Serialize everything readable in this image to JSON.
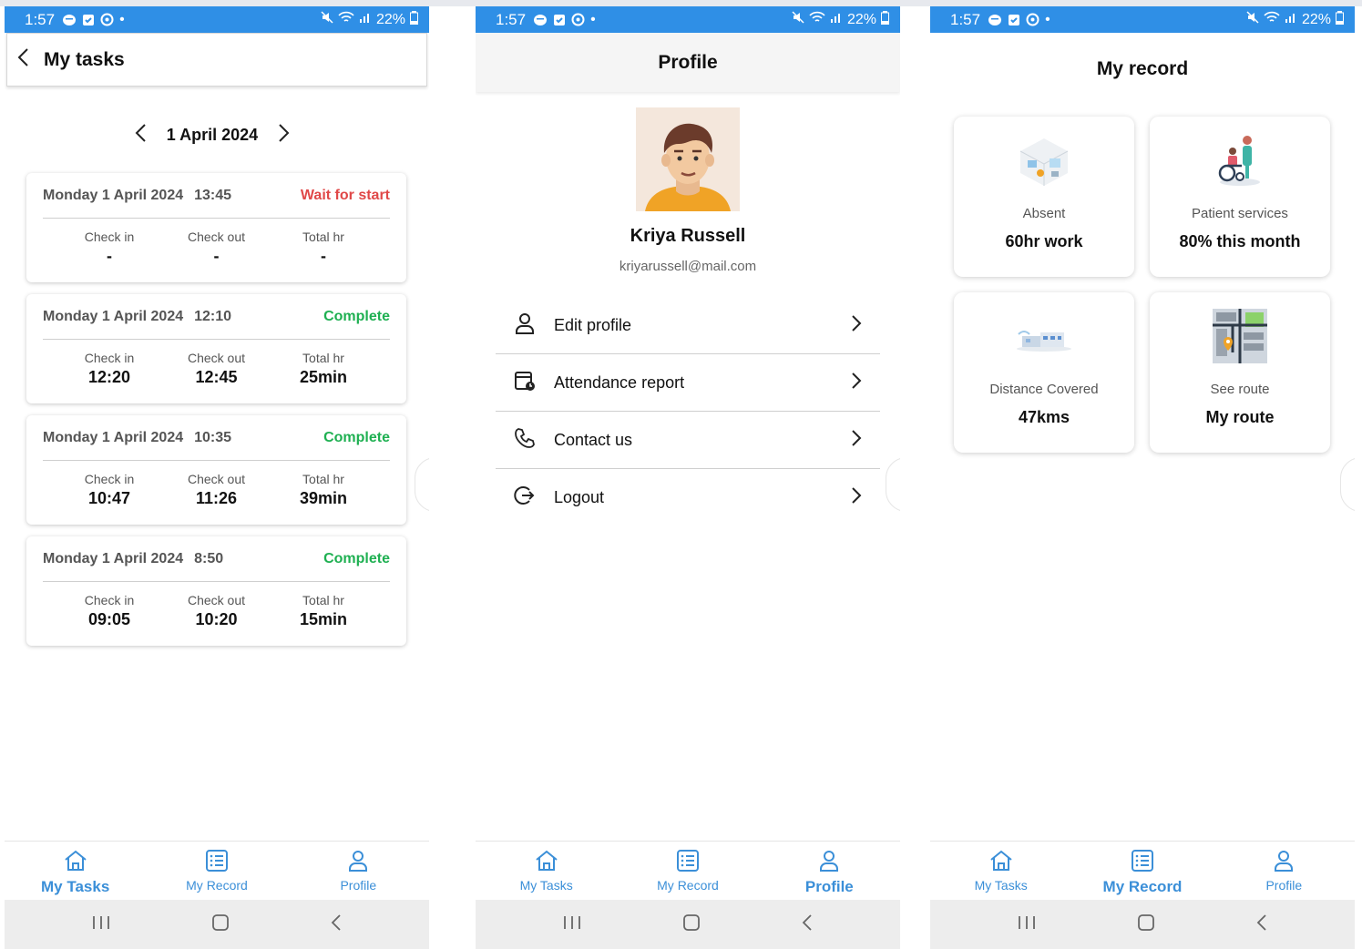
{
  "statusbar": {
    "time": "1:57",
    "battery": "22%"
  },
  "tasks": {
    "title": "My tasks",
    "date": "1 April 2024",
    "col_labels": {
      "checkin": "Check in",
      "checkout": "Check out",
      "total": "Total hr"
    },
    "cards": [
      {
        "day": "Monday 1 April 2024",
        "time": "13:45",
        "status": "Wait for start",
        "status_type": "wait",
        "checkin": "-",
        "checkout": "-",
        "total": "-"
      },
      {
        "day": "Monday 1 April 2024",
        "time": "12:10",
        "status": "Complete",
        "status_type": "complete",
        "checkin": "12:20",
        "checkout": "12:45",
        "total": "25min"
      },
      {
        "day": "Monday 1 April 2024",
        "time": "10:35",
        "status": "Complete",
        "status_type": "complete",
        "checkin": "10:47",
        "checkout": "11:26",
        "total": "39min"
      },
      {
        "day": "Monday 1 April 2024",
        "time": "8:50",
        "status": "Complete",
        "status_type": "complete",
        "checkin": "09:05",
        "checkout": "10:20",
        "total": "15min"
      }
    ]
  },
  "profile": {
    "title": "Profile",
    "name": "Kriya Russell",
    "email": "kriyarussell@mail.com",
    "menu": [
      {
        "label": "Edit profile",
        "icon": "person-icon"
      },
      {
        "label": "Attendance report",
        "icon": "attendance-icon"
      },
      {
        "label": "Contact us",
        "icon": "phone-icon"
      },
      {
        "label": "Logout",
        "icon": "logout-icon"
      }
    ]
  },
  "record": {
    "title": "My record",
    "cards": [
      {
        "label": "Absent",
        "value": "60hr work",
        "icon": "room-illustration-icon"
      },
      {
        "label": "Patient services",
        "value": "80% this month",
        "icon": "wheelchair-illustration-icon"
      },
      {
        "label": "Distance Covered",
        "value": "47kms",
        "icon": "building-illustration-icon"
      },
      {
        "label": "See route",
        "value": "My route",
        "icon": "map-illustration-icon"
      }
    ]
  },
  "nav": {
    "tasks": "My Tasks",
    "record": "My Record",
    "profile": "Profile"
  },
  "colors": {
    "statusbar": "#2f8fe6",
    "nav_accent": "#3b8fd8",
    "wait": "#e04848",
    "complete": "#1fb052"
  }
}
